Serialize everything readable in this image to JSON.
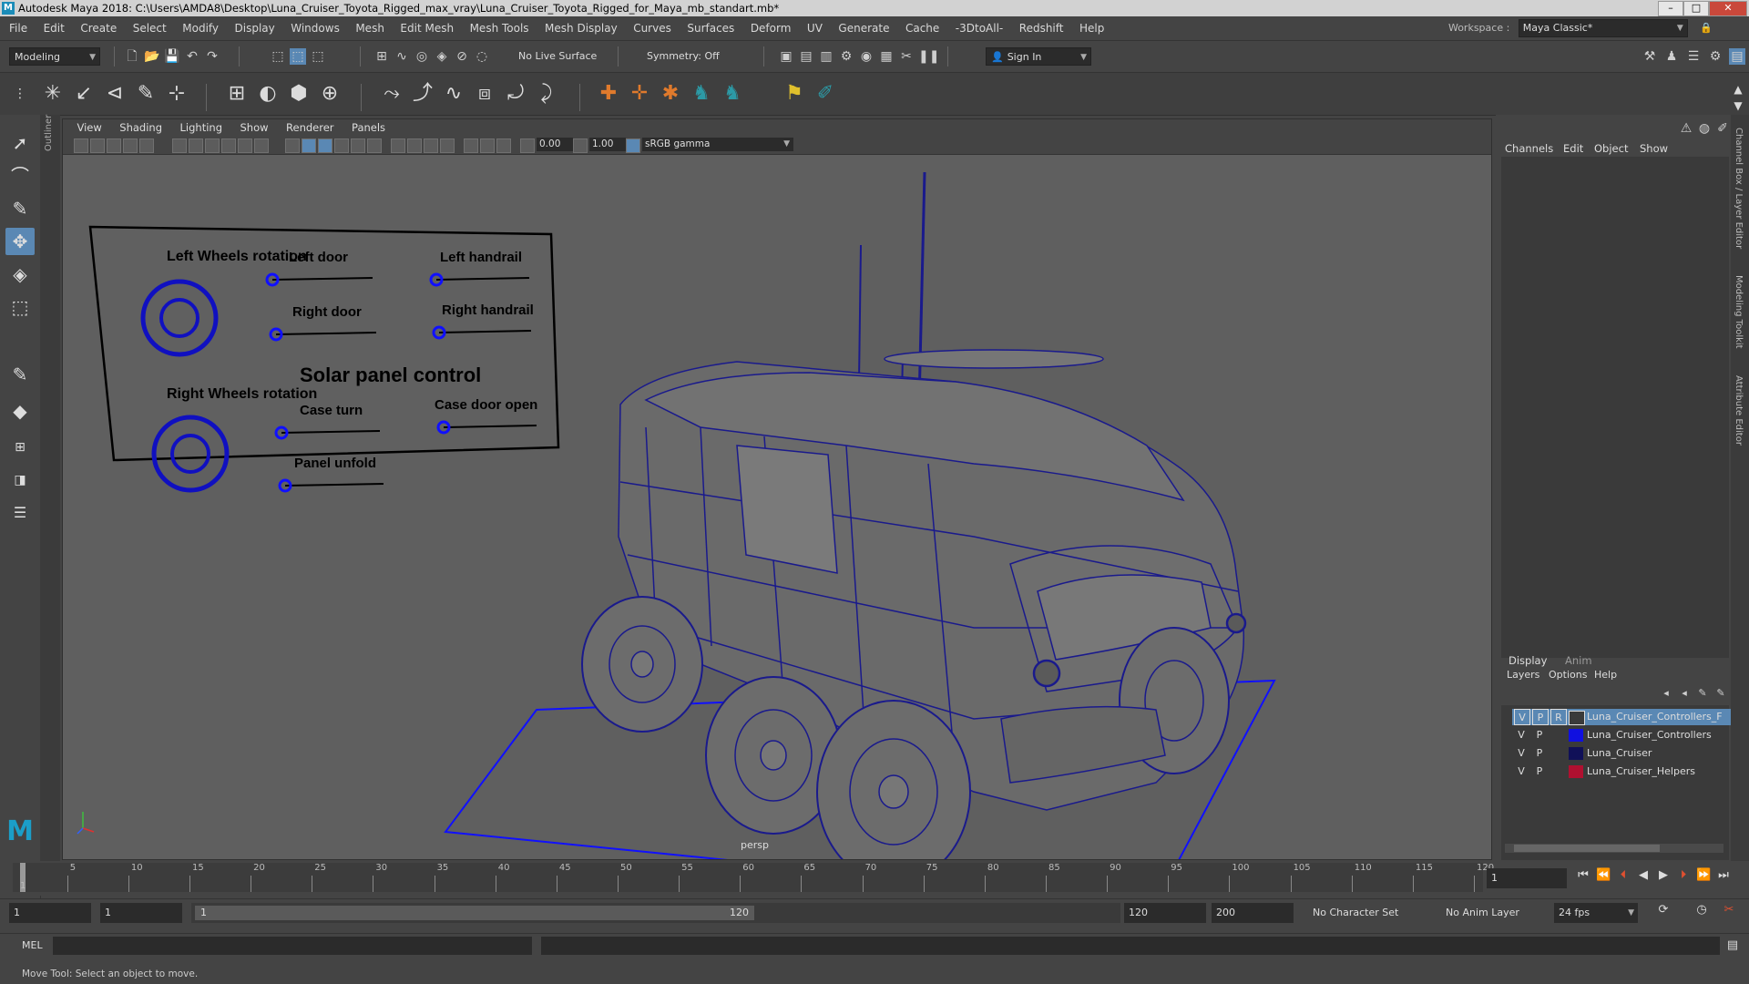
{
  "window": {
    "title": "Autodesk Maya 2018: C:\\Users\\AMDA8\\Desktop\\Luna_Cruiser_Toyota_Rigged_max_vray\\Luna_Cruiser_Toyota_Rigged_for_Maya_mb_standart.mb*",
    "minimize": "–",
    "maximize": "□",
    "close": "✕"
  },
  "menubar": {
    "items": [
      "File",
      "Edit",
      "Create",
      "Select",
      "Modify",
      "Display",
      "Windows",
      "Mesh",
      "Edit Mesh",
      "Mesh Tools",
      "Mesh Display",
      "Curves",
      "Surfaces",
      "Deform",
      "UV",
      "Generate",
      "Cache",
      "-3DtoAll-",
      "Redshift",
      "Help"
    ],
    "workspace_label": "Workspace :",
    "workspace_value": "Maya Classic*"
  },
  "statusline": {
    "mode": "Modeling",
    "live_surface": "No Live Surface",
    "symmetry": "Symmetry: Off",
    "sign_in": "Sign In"
  },
  "viewport": {
    "menu": [
      "View",
      "Shading",
      "Lighting",
      "Show",
      "Renderer",
      "Panels"
    ],
    "field_a": "0.00",
    "field_b": "1.00",
    "colorspace": "sRGB gamma",
    "camera_label": "persp"
  },
  "control_panel": {
    "left_wheels": "Left Wheels rotation",
    "right_wheels": "Right Wheels rotation",
    "left_door": "Left door",
    "right_door": "Right door",
    "left_handrail": "Left handrail",
    "right_handrail": "Right handrail",
    "solar": "Solar panel control",
    "case_turn": "Case turn",
    "case_door": "Case door open",
    "panel_unfold": "Panel unfold"
  },
  "right_panel": {
    "channel_tabs": [
      "Channels",
      "Edit",
      "Object",
      "Show"
    ],
    "vertical_tabs": [
      "Channel Box / Layer Editor",
      "Modeling Toolkit",
      "Attribute Editor"
    ],
    "display_tabs": [
      "Display",
      "Anim"
    ],
    "layer_menu": [
      "Layers",
      "Options",
      "Help"
    ],
    "layers": [
      {
        "v": "V",
        "p": "P",
        "r": "R",
        "name": "Luna_Cruiser_Controllers_Freeze",
        "color": "#3a3a3a",
        "selected": true
      },
      {
        "v": "V",
        "p": "P",
        "r": "",
        "name": "Luna_Cruiser_Controllers",
        "color": "#1010e0",
        "selected": false
      },
      {
        "v": "V",
        "p": "P",
        "r": "",
        "name": "Luna_Cruiser",
        "color": "#101058",
        "selected": false
      },
      {
        "v": "V",
        "p": "P",
        "r": "",
        "name": "Luna_Cruiser_Helpers",
        "color": "#b01030",
        "selected": false
      }
    ]
  },
  "timeline": {
    "ticks": [
      "5",
      "10",
      "15",
      "20",
      "25",
      "30",
      "35",
      "40",
      "45",
      "50",
      "55",
      "60",
      "65",
      "70",
      "75",
      "80",
      "85",
      "90",
      "95",
      "100",
      "105",
      "110",
      "115",
      "120"
    ],
    "start_marker": "1",
    "current_frame": "1"
  },
  "range": {
    "start": "1",
    "playback_start": "1",
    "slider_start": "1",
    "slider_end": "120",
    "playback_end": "120",
    "end": "200",
    "character_set": "No Character Set",
    "anim_layer": "No Anim Layer",
    "fps": "24 fps"
  },
  "cmdline": {
    "label": "MEL"
  },
  "helpline": {
    "text": "Move Tool: Select an object to move."
  },
  "colors": {
    "wire": "#1a1a8c",
    "selected_blue": "#1010ff",
    "active_tool": "#5a88b4"
  }
}
